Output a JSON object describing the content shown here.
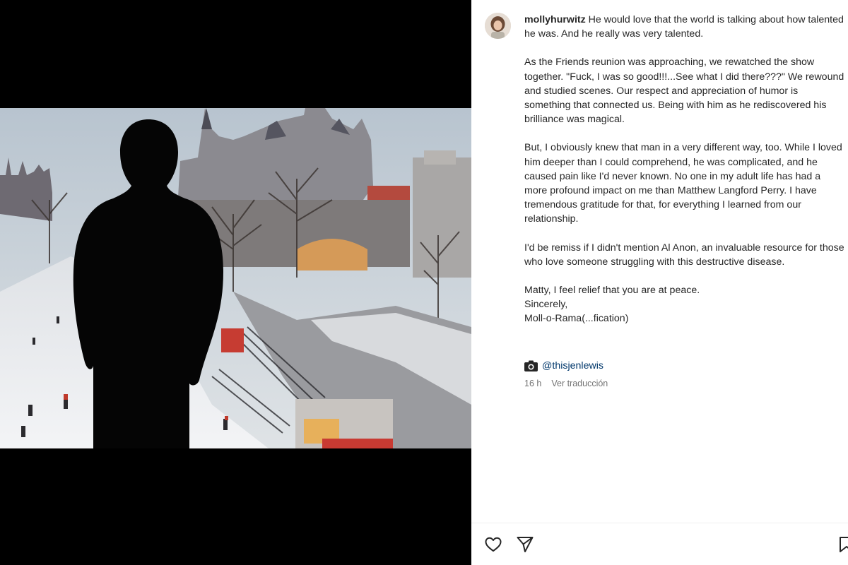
{
  "post": {
    "username": "mollyhurwitz",
    "caption_intro": "He would love that the world is talking about how talented he was. And he really was very talented.",
    "paragraphs": [
      "As the Friends reunion was approaching, we rewatched the show together. \"Fuck, I was so good!!!...See what I did there???\" We rewound and studied scenes. Our respect and appreciation of humor is something that connected us. Being with him as he rediscovered his brilliance was magical.",
      "But, I obviously knew that man in a very different way, too. While I loved him deeper than I could comprehend, he was complicated, and he caused pain like I'd never known. No one in my adult life has had a more profound impact on me than Matthew Langford Perry. I have tremendous gratitude for that, for everything I learned from our relationship.",
      "I'd be remiss if I didn't mention Al Anon, an invaluable resource for those who love someone struggling with this destructive disease."
    ],
    "signoff_lines": [
      "Matty, I feel relief that you are at peace.",
      "Sincerely,",
      "Moll-o-Rama(...fication)"
    ],
    "photo_credit": "@thisjenlewis",
    "timestamp": "16 h",
    "translate_label": "Ver traducción"
  },
  "icons": {
    "avatar": "avatar",
    "camera": "camera-icon",
    "like": "heart-icon",
    "share": "paper-plane-icon",
    "save": "bookmark-icon"
  },
  "colors": {
    "text": "#262626",
    "muted": "#737373",
    "link": "#00376b",
    "media_background": "#000000"
  }
}
